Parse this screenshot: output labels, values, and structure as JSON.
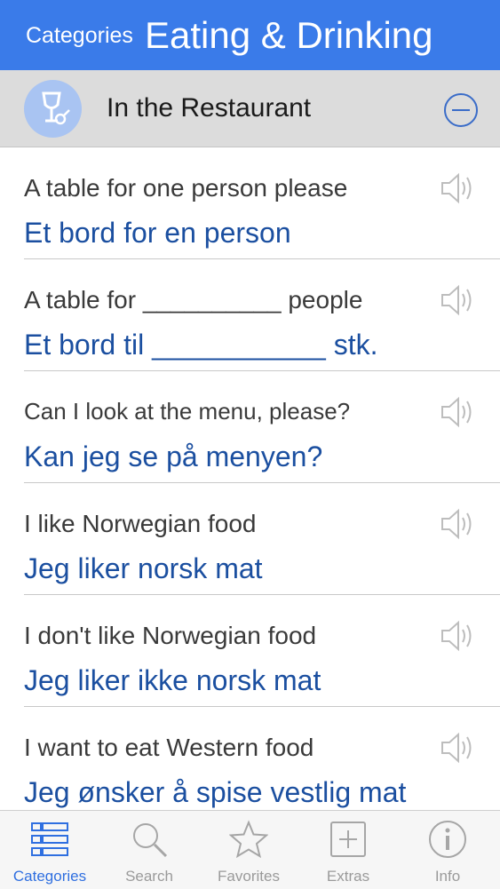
{
  "nav": {
    "back_label": "Categories",
    "title": "Eating & Drinking"
  },
  "category": {
    "label": "In the Restaurant",
    "icon": "wine-glass-corkscrew-icon"
  },
  "phrases": [
    {
      "english": "A table for one person please",
      "norwegian": "Et bord for en person"
    },
    {
      "english": "A table for __________ people",
      "norwegian": "Et bord til ___________ stk."
    },
    {
      "english": "Can I look at the menu, please?",
      "norwegian": "Kan jeg se på menyen?"
    },
    {
      "english": "I like Norwegian food",
      "norwegian": "Jeg liker norsk mat"
    },
    {
      "english": "I don't like Norwegian food",
      "norwegian": "Jeg liker ikke norsk mat"
    },
    {
      "english": "I want to eat Western food",
      "norwegian": "Jeg ønsker å spise vestlig mat"
    }
  ],
  "tabs": [
    {
      "label": "Categories",
      "icon": "categories-list-icon",
      "active": true
    },
    {
      "label": "Search",
      "icon": "search-icon",
      "active": false
    },
    {
      "label": "Favorites",
      "icon": "star-icon",
      "active": false
    },
    {
      "label": "Extras",
      "icon": "plus-box-icon",
      "active": false
    },
    {
      "label": "Info",
      "icon": "info-icon",
      "active": false
    }
  ],
  "colors": {
    "nav_bg": "#3a7be9",
    "category_bar_bg": "#dcdcdc",
    "norwegian_text": "#1b4fa0",
    "active_tab": "#2f6fe0",
    "inactive_tab": "#9a9a9a"
  }
}
